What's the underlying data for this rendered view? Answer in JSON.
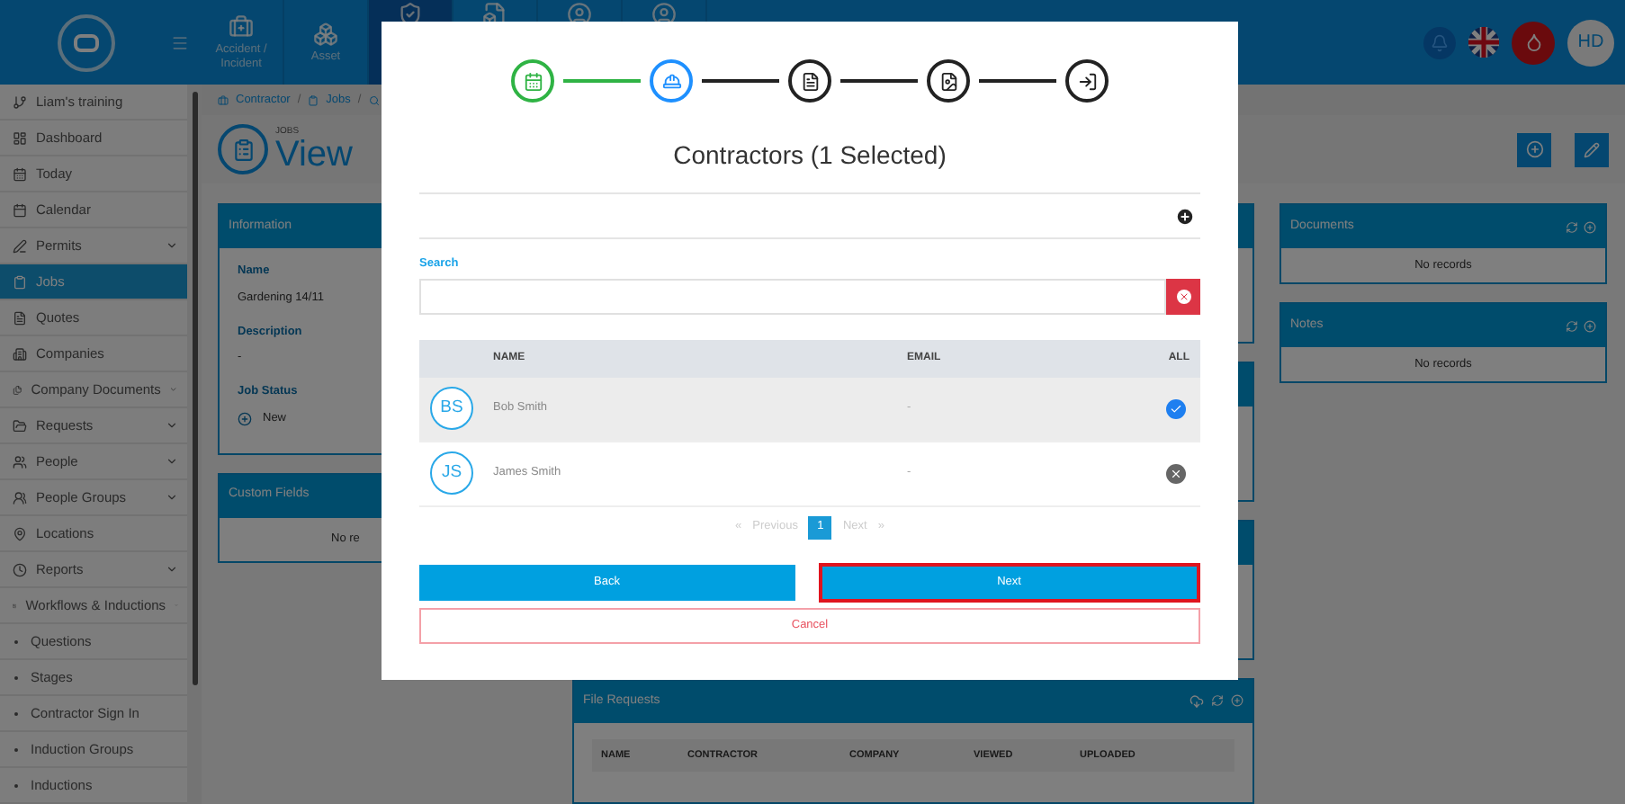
{
  "header": {
    "nav_tiles": [
      {
        "label": "Accident / Incident",
        "selected": false
      },
      {
        "label": "Asset",
        "selected": false
      },
      {
        "selected": true
      },
      {
        "selected": false
      },
      {
        "selected": false
      },
      {
        "selected": false
      }
    ],
    "avatar": "HD"
  },
  "sidebar": {
    "items": [
      {
        "label": "Liam's training",
        "kind": "workspace",
        "selected": false,
        "expandable": false
      },
      {
        "label": "Dashboard",
        "kind": "item",
        "selected": false,
        "expandable": false
      },
      {
        "label": "Today",
        "kind": "item",
        "selected": false,
        "expandable": false
      },
      {
        "label": "Calendar",
        "kind": "item",
        "selected": false,
        "expandable": false
      },
      {
        "label": "Permits",
        "kind": "item",
        "selected": false,
        "expandable": true
      },
      {
        "label": "Jobs",
        "kind": "item",
        "selected": true,
        "expandable": false
      },
      {
        "label": "Quotes",
        "kind": "item",
        "selected": false,
        "expandable": false
      },
      {
        "label": "Companies",
        "kind": "item",
        "selected": false,
        "expandable": false
      },
      {
        "label": "Company Documents",
        "kind": "item",
        "selected": false,
        "expandable": true
      },
      {
        "label": "Requests",
        "kind": "item",
        "selected": false,
        "expandable": true
      },
      {
        "label": "People",
        "kind": "item",
        "selected": false,
        "expandable": true
      },
      {
        "label": "People Groups",
        "kind": "item",
        "selected": false,
        "expandable": true
      },
      {
        "label": "Locations",
        "kind": "item",
        "selected": false,
        "expandable": false
      },
      {
        "label": "Reports",
        "kind": "item",
        "selected": false,
        "expandable": true
      },
      {
        "label": "Workflows & Inductions",
        "kind": "item",
        "selected": false,
        "expandable": true
      },
      {
        "label": "Questions",
        "kind": "subitem",
        "selected": false,
        "expandable": false
      },
      {
        "label": "Stages",
        "kind": "subitem",
        "selected": false,
        "expandable": false
      },
      {
        "label": "Contractor Sign In",
        "kind": "subitem",
        "selected": false,
        "expandable": false
      },
      {
        "label": "Induction Groups",
        "kind": "subitem",
        "selected": false,
        "expandable": false
      },
      {
        "label": "Inductions",
        "kind": "subitem",
        "selected": false,
        "expandable": false
      }
    ]
  },
  "breadcrumb": {
    "items": [
      "Contractor",
      "Jobs"
    ],
    "separator": "/"
  },
  "page": {
    "overline": "JOBS",
    "title": "View"
  },
  "information": {
    "title": "Information",
    "fields": [
      {
        "label": "Name",
        "value": "Gardening 14/11"
      },
      {
        "label": "Description",
        "value": "-"
      },
      {
        "label": "Job Status",
        "value": "New"
      }
    ]
  },
  "custom_fields": {
    "title": "Custom Fields",
    "empty": "No re"
  },
  "file_requests": {
    "title": "File Requests",
    "columns": [
      "NAME",
      "CONTRACTOR",
      "COMPANY",
      "VIEWED",
      "UPLOADED"
    ]
  },
  "documents": {
    "title": "Documents",
    "empty": "No records"
  },
  "notes": {
    "title": "Notes",
    "empty": "No records"
  },
  "modal": {
    "steps": [
      {
        "done": true,
        "current": false
      },
      {
        "done": false,
        "current": true
      },
      {
        "done": false,
        "current": false
      },
      {
        "done": false,
        "current": false
      },
      {
        "done": false,
        "current": false
      }
    ],
    "title": "Contractors (1 Selected)",
    "search": {
      "label": "Search"
    },
    "table": {
      "columns": [
        "NAME",
        "EMAIL",
        "ALL"
      ],
      "rows": [
        {
          "initials": "BS",
          "name": "Bob Smith",
          "email": "-",
          "selected": true
        },
        {
          "initials": "JS",
          "name": "James Smith",
          "email": "-",
          "selected": false
        }
      ]
    },
    "pagination": {
      "prev_glyph": "«",
      "previous": "Previous",
      "pages": [
        {
          "label": "1",
          "selected": true
        }
      ],
      "next": "Next",
      "next_glyph": "»"
    },
    "buttons": {
      "back": "Back",
      "next": "Next",
      "next_focused": true,
      "cancel": "Cancel"
    }
  }
}
